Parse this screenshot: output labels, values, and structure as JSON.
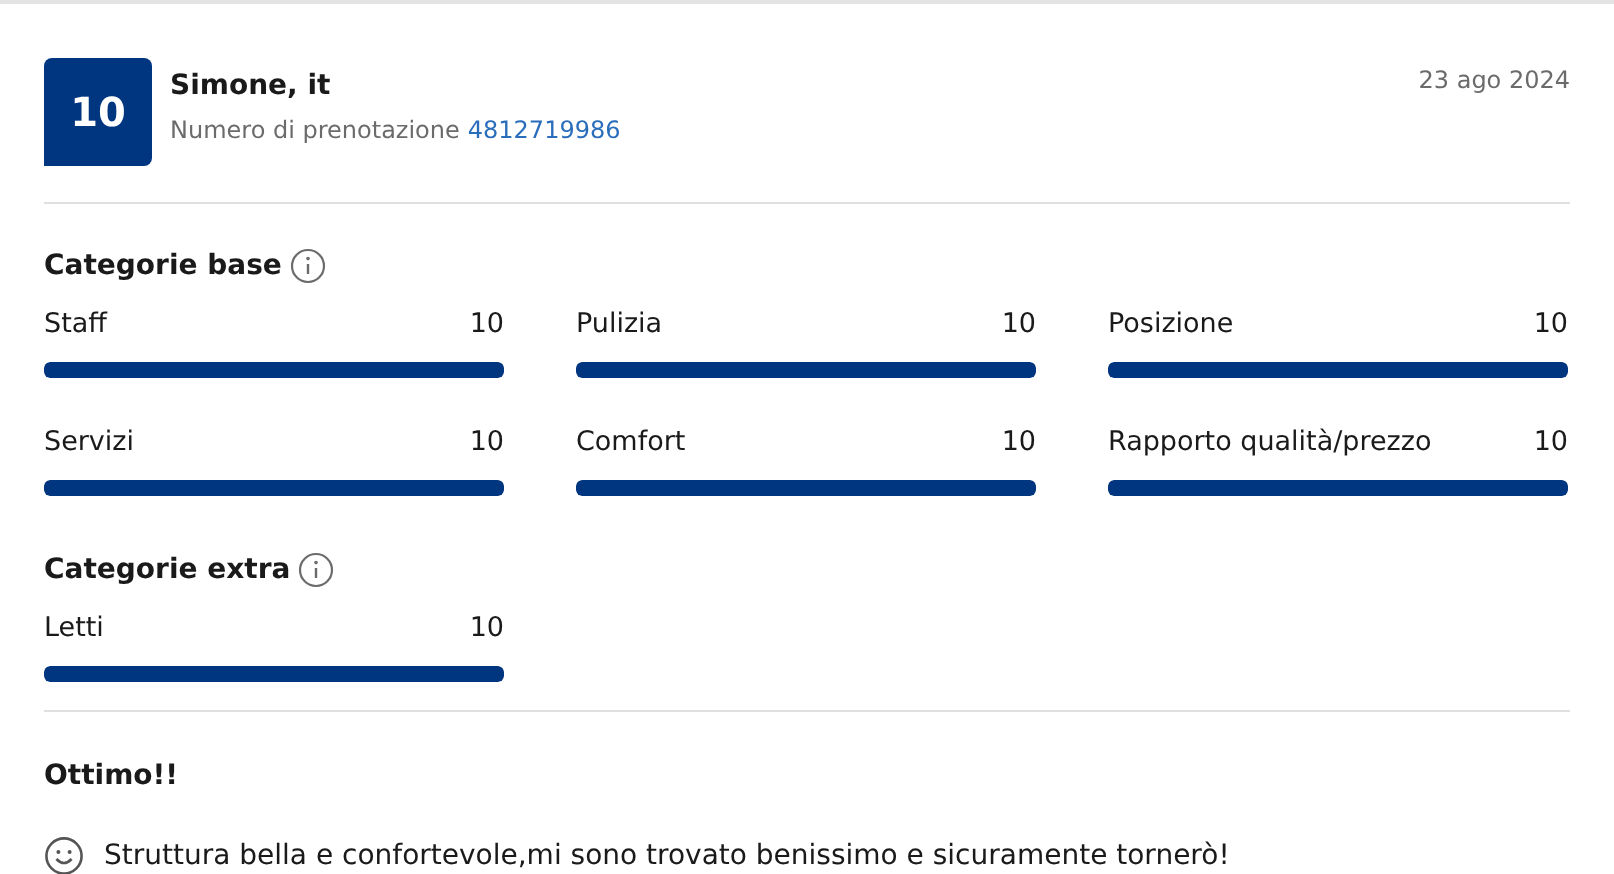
{
  "review": {
    "score": "10",
    "name": "Simone, it",
    "booking_label": "Numero di prenotazione",
    "booking_number": "4812719986",
    "date": "23 ago 2024"
  },
  "sections": [
    {
      "title": "Categorie base",
      "categories": [
        {
          "label": "Staff",
          "score": "10",
          "level": 1
        },
        {
          "label": "Pulizia",
          "score": "10",
          "level": 1
        },
        {
          "label": "Posizione",
          "score": "10",
          "level": 1
        },
        {
          "label": "Servizi",
          "score": "10",
          "level": 1
        },
        {
          "label": "Comfort",
          "score": "10",
          "level": 1
        },
        {
          "label": "Rapporto qualità/prezzo",
          "score": "10",
          "level": 1
        }
      ]
    },
    {
      "title": "Categorie extra",
      "categories": [
        {
          "label": "Letti",
          "score": "10",
          "level": 1
        }
      ]
    }
  ],
  "comment": {
    "title": "Ottimo!!",
    "text": "Struttura bella e confortevole,mi sono trovato benissimo e sicuramente tornerò!"
  }
}
